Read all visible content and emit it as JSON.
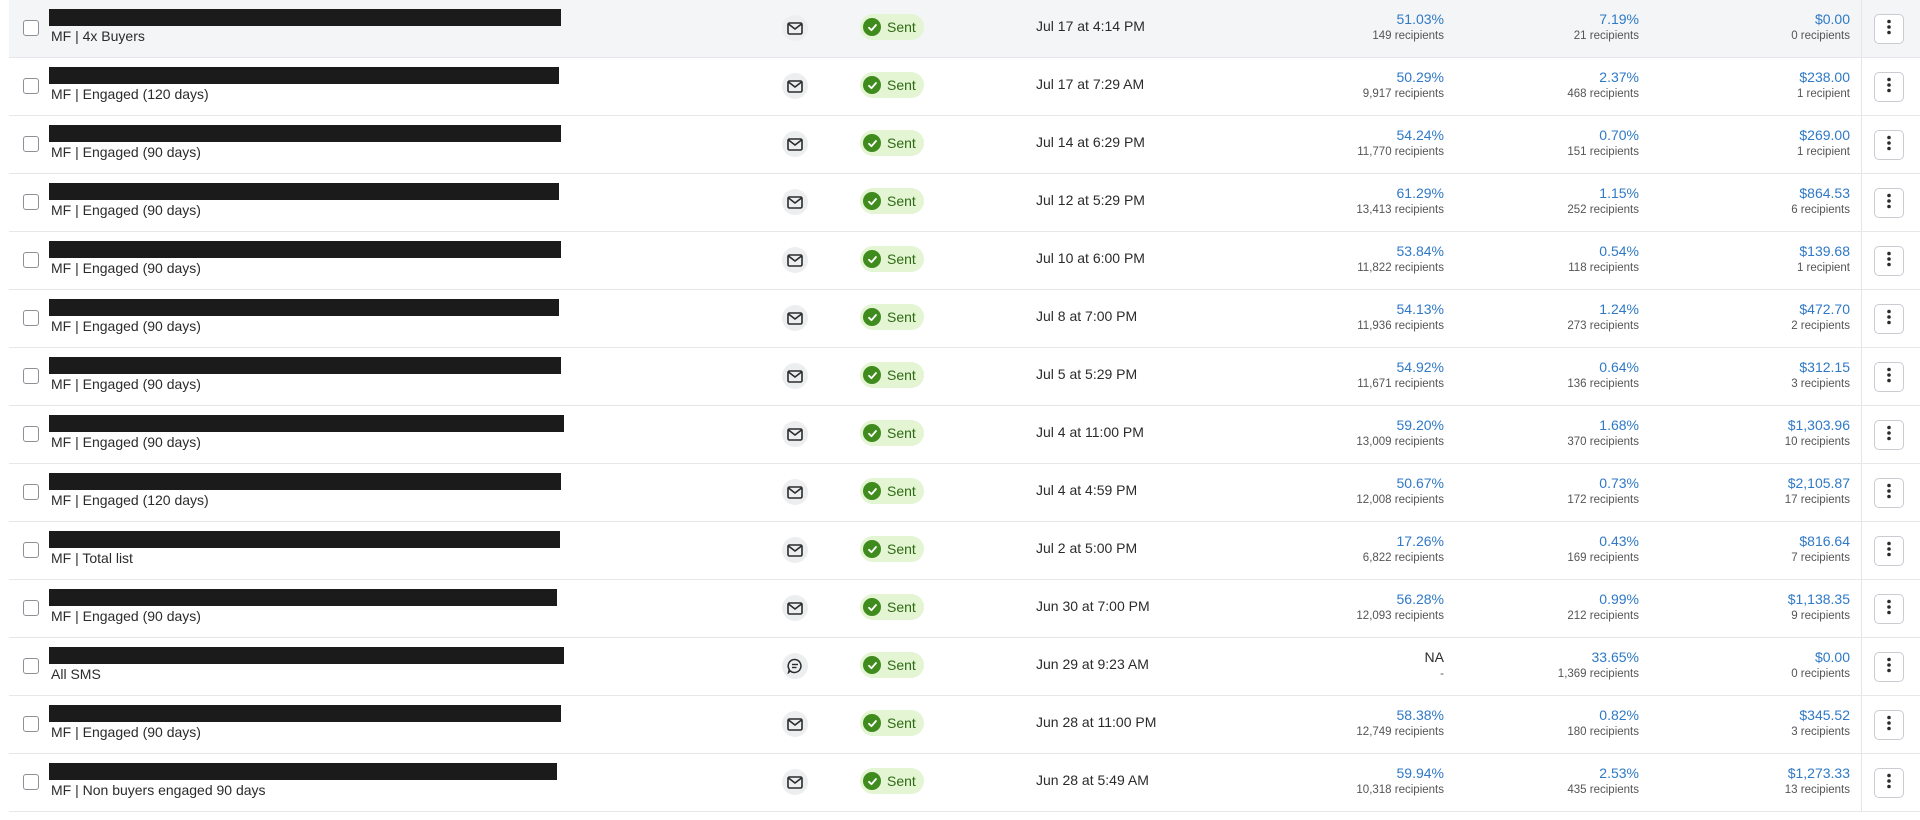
{
  "rows": [
    {
      "list": "MF | 4x Buyers",
      "channel": "email-icon",
      "status": "Sent",
      "date": "Jul 17 at 4:14 PM",
      "open_rate": "51.03%",
      "open_recipients": "149 recipients",
      "click_rate": "7.19%",
      "click_recipients": "21 recipients",
      "revenue": "$0.00",
      "revenue_recipients": "0 recipients",
      "highlighted": true
    },
    {
      "list": "MF | Engaged (120 days)",
      "channel": "email-icon",
      "status": "Sent",
      "date": "Jul 17 at 7:29 AM",
      "open_rate": "50.29%",
      "open_recipients": "9,917 recipients",
      "click_rate": "2.37%",
      "click_recipients": "468 recipients",
      "revenue": "$238.00",
      "revenue_recipients": "1 recipient"
    },
    {
      "list": "MF | Engaged (90 days)",
      "channel": "email-icon",
      "status": "Sent",
      "date": "Jul 14 at 6:29 PM",
      "open_rate": "54.24%",
      "open_recipients": "11,770 recipients",
      "click_rate": "0.70%",
      "click_recipients": "151 recipients",
      "revenue": "$269.00",
      "revenue_recipients": "1 recipient"
    },
    {
      "list": "MF | Engaged (90 days)",
      "channel": "email-icon",
      "status": "Sent",
      "date": "Jul 12 at 5:29 PM",
      "open_rate": "61.29%",
      "open_recipients": "13,413 recipients",
      "click_rate": "1.15%",
      "click_recipients": "252 recipients",
      "revenue": "$864.53",
      "revenue_recipients": "6 recipients"
    },
    {
      "list": "MF | Engaged (90 days)",
      "channel": "email-icon",
      "status": "Sent",
      "date": "Jul 10 at 6:00 PM",
      "open_rate": "53.84%",
      "open_recipients": "11,822 recipients",
      "click_rate": "0.54%",
      "click_recipients": "118 recipients",
      "revenue": "$139.68",
      "revenue_recipients": "1 recipient"
    },
    {
      "list": "MF | Engaged (90 days)",
      "channel": "email-icon",
      "status": "Sent",
      "date": "Jul 8 at 7:00 PM",
      "open_rate": "54.13%",
      "open_recipients": "11,936 recipients",
      "click_rate": "1.24%",
      "click_recipients": "273 recipients",
      "revenue": "$472.70",
      "revenue_recipients": "2 recipients"
    },
    {
      "list": "MF | Engaged (90 days)",
      "channel": "email-icon",
      "status": "Sent",
      "date": "Jul 5 at 5:29 PM",
      "open_rate": "54.92%",
      "open_recipients": "11,671 recipients",
      "click_rate": "0.64%",
      "click_recipients": "136 recipients",
      "revenue": "$312.15",
      "revenue_recipients": "3 recipients"
    },
    {
      "list": "MF | Engaged (90 days)",
      "channel": "email-icon",
      "status": "Sent",
      "date": "Jul 4 at 11:00 PM",
      "open_rate": "59.20%",
      "open_recipients": "13,009 recipients",
      "click_rate": "1.68%",
      "click_recipients": "370 recipients",
      "revenue": "$1,303.96",
      "revenue_recipients": "10 recipients"
    },
    {
      "list": "MF | Engaged (120 days)",
      "channel": "email-icon",
      "status": "Sent",
      "date": "Jul 4 at 4:59 PM",
      "open_rate": "50.67%",
      "open_recipients": "12,008 recipients",
      "click_rate": "0.73%",
      "click_recipients": "172 recipients",
      "revenue": "$2,105.87",
      "revenue_recipients": "17 recipients"
    },
    {
      "list": "MF | Total list",
      "channel": "email-icon",
      "status": "Sent",
      "date": "Jul 2 at 5:00 PM",
      "open_rate": "17.26%",
      "open_recipients": "6,822 recipients",
      "click_rate": "0.43%",
      "click_recipients": "169 recipients",
      "revenue": "$816.64",
      "revenue_recipients": "7 recipients"
    },
    {
      "list": "MF | Engaged (90 days)",
      "channel": "email-icon",
      "status": "Sent",
      "date": "Jun 30 at 7:00 PM",
      "open_rate": "56.28%",
      "open_recipients": "12,093 recipients",
      "click_rate": "0.99%",
      "click_recipients": "212 recipients",
      "revenue": "$1,138.35",
      "revenue_recipients": "9 recipients"
    },
    {
      "list": "All SMS",
      "channel": "sms-icon",
      "status": "Sent",
      "date": "Jun 29 at 9:23 AM",
      "open_rate": "NA",
      "open_recipients": "-",
      "click_rate": "33.65%",
      "click_recipients": "1,369 recipients",
      "revenue": "$0.00",
      "revenue_recipients": "0 recipients"
    },
    {
      "list": "MF | Engaged (90 days)",
      "channel": "email-icon",
      "status": "Sent",
      "date": "Jun 28 at 11:00 PM",
      "open_rate": "58.38%",
      "open_recipients": "12,749 recipients",
      "click_rate": "0.82%",
      "click_recipients": "180 recipients",
      "revenue": "$345.52",
      "revenue_recipients": "3 recipients"
    },
    {
      "list": "MF | Non buyers engaged 90 days",
      "channel": "email-icon",
      "status": "Sent",
      "date": "Jun 28 at 5:49 AM",
      "open_rate": "59.94%",
      "open_recipients": "10,318 recipients",
      "click_rate": "2.53%",
      "click_recipients": "435 recipients",
      "revenue": "$1,273.33",
      "revenue_recipients": "13 recipients"
    }
  ],
  "colors": {
    "link": "#2f79c7",
    "status_bg": "#e3f5d2",
    "status_icon": "#3f8b1e",
    "redaction": "#1b1b1b"
  }
}
